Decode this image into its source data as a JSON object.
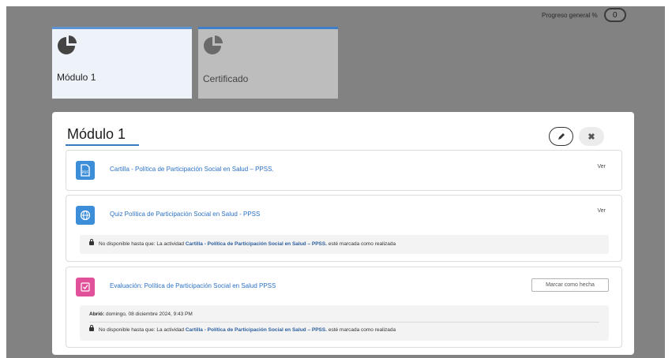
{
  "progress": {
    "label": "Progreso general %",
    "value": "0"
  },
  "tiles": [
    {
      "title": "Módulo 1",
      "icon": "pie-chart-icon"
    },
    {
      "title": "Certificado",
      "icon": "pie-chart-icon"
    }
  ],
  "modal": {
    "title": "Módulo 1",
    "edit_icon": "pencil-icon",
    "close_icon": "close-icon",
    "activities": [
      {
        "icon": "pdf-file-icon",
        "title": "Cartilla - Política de Participación Social en Salud – PPSS.",
        "action": "Ver"
      },
      {
        "icon": "globe-icon",
        "title": "Quiz Política de Participación Social en Salud - PPSS",
        "action": "Ver",
        "restriction_prefix": "No disponible hasta que: La actividad",
        "restriction_link": "Cartilla - Política de Participación Social en Salud – PPSS.",
        "restriction_suffix": "esté marcada como realizada"
      },
      {
        "icon": "checkbox-icon",
        "title": "Evaluación: Política de Participación Social en Salud PPSS",
        "action": "Marcar como hecha",
        "opened_label": "Abrió:",
        "opened_date": "domingo, 08 diciembre 2024, 9:43 PM",
        "restriction_prefix": "No disponible hasta que: La actividad",
        "restriction_link": "Cartilla - Política de Participación Social en Salud – PPSS.",
        "restriction_suffix": "esté marcada como realizada"
      }
    ]
  },
  "colors": {
    "accent": "#3d8ed9",
    "pink": "#e0519a",
    "link": "#2c72c4",
    "overlay": "#828282"
  }
}
